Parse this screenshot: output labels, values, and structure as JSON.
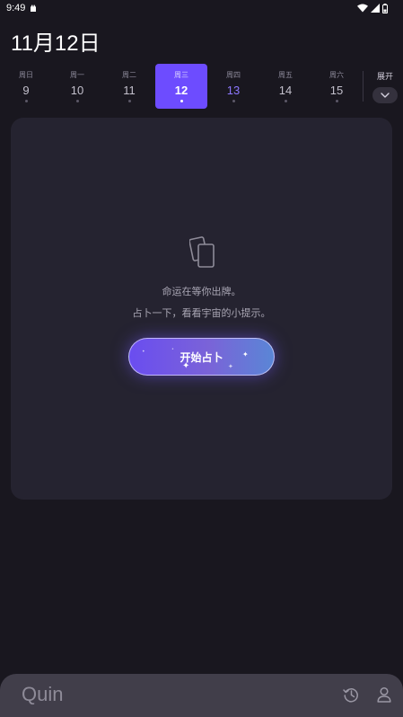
{
  "status_bar": {
    "time": "9:49"
  },
  "header": {
    "date": "11月12日"
  },
  "week": {
    "days": [
      {
        "name": "周日",
        "num": "9"
      },
      {
        "name": "周一",
        "num": "10"
      },
      {
        "name": "周二",
        "num": "11"
      },
      {
        "name": "周三",
        "num": "12"
      },
      {
        "name": "周四",
        "num": "13"
      },
      {
        "name": "周五",
        "num": "14"
      },
      {
        "name": "周六",
        "num": "15"
      }
    ],
    "selected_index": 3,
    "accent_index": 4,
    "expand_label": "展开"
  },
  "card": {
    "message_line1": "命运在等你出牌。",
    "message_line2": "占卜一下，看看宇宙的小提示。",
    "start_button_label": "开始占卜"
  },
  "bottom_bar": {
    "logo": "Quin"
  },
  "colors": {
    "background": "#19171f",
    "card": "#252330",
    "accent": "#6d4cff",
    "accent_text": "#8d78ff",
    "bottom_bar": "#413e4a"
  },
  "icons": [
    "notification-app-icon",
    "wifi-icon",
    "signal-icon",
    "battery-icon",
    "chevron-down-icon",
    "cards-icon",
    "history-icon",
    "profile-icon"
  ]
}
